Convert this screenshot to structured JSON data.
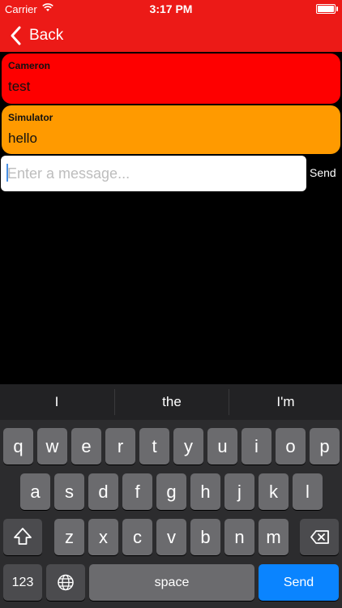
{
  "status_bar": {
    "carrier": "Carrier",
    "time": "3:17 PM"
  },
  "nav": {
    "back_label": "Back",
    "color": "#ec1a17"
  },
  "messages": [
    {
      "sender": "Cameron",
      "text": "test",
      "color": "#fe0000"
    },
    {
      "sender": "Simulator",
      "text": "hello",
      "color": "#ff9a00"
    }
  ],
  "composer": {
    "placeholder": "Enter a message...",
    "value": "",
    "send_label": "Send"
  },
  "keyboard": {
    "suggestions": [
      "I",
      "the",
      "I'm"
    ],
    "row1": [
      "q",
      "w",
      "e",
      "r",
      "t",
      "y",
      "u",
      "i",
      "o",
      "p"
    ],
    "row2": [
      "a",
      "s",
      "d",
      "f",
      "g",
      "h",
      "j",
      "k",
      "l"
    ],
    "row3": [
      "z",
      "x",
      "c",
      "v",
      "b",
      "n",
      "m"
    ],
    "numbers_label": "123",
    "space_label": "space",
    "return_label": "Send",
    "return_color": "#0a84ff"
  }
}
